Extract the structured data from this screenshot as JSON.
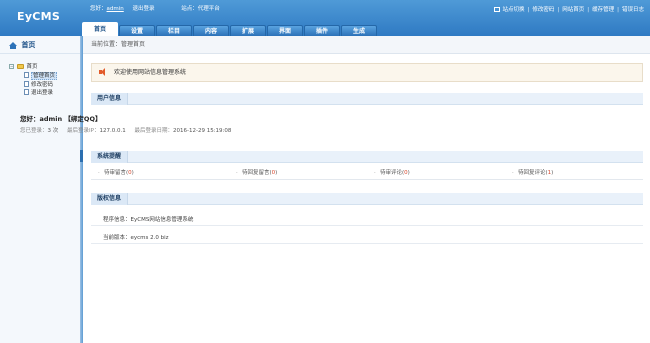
{
  "app": {
    "logo": "EyCMS"
  },
  "topbar": {
    "greeting": "您好：",
    "username": "admin",
    "logout": "退出登录",
    "site_label": "站点：代理平台",
    "links": [
      "站点切换",
      "修改密码",
      "网站首页",
      "缓存管理",
      "错误日志"
    ]
  },
  "tabs": [
    {
      "label": "首页",
      "active": true
    },
    {
      "label": "设置"
    },
    {
      "label": "栏目"
    },
    {
      "label": "内容"
    },
    {
      "label": "扩展"
    },
    {
      "label": "界面"
    },
    {
      "label": "插件"
    },
    {
      "label": "生成"
    }
  ],
  "sidebar": {
    "title": "首页",
    "tree_root": "首页",
    "items": [
      {
        "label": "管理首页",
        "active": true
      },
      {
        "label": "修改密码"
      },
      {
        "label": "退出登录"
      }
    ]
  },
  "main": {
    "breadcrumb": "当前位置：管理首页",
    "welcome": "欢迎使用网站信息管理系统",
    "user_panel": {
      "title": "用户信息",
      "hello": "您好：admin   【绑定QQ】",
      "login_count_label": "您已登录：",
      "login_count": "3 次",
      "last_ip_label": "最后登录IP：",
      "last_ip": "127.0.0.1",
      "last_time_label": "最后登录日期：",
      "last_time": "2016-12-29 15:19:08"
    },
    "system_panel": {
      "title": "系统提醒",
      "stats": [
        {
          "label": "待审留言",
          "value": "0"
        },
        {
          "label": "待回复留言",
          "value": "0"
        },
        {
          "label": "待审评论",
          "value": "0"
        },
        {
          "label": "待回复评论",
          "value": "1"
        }
      ]
    },
    "copyright_panel": {
      "title": "版权信息",
      "program_label": "程序信息：",
      "program": "EyCMS网站信息管理系统",
      "version_label": "当前版本：",
      "version": "eycms 2.0 biz"
    }
  }
}
